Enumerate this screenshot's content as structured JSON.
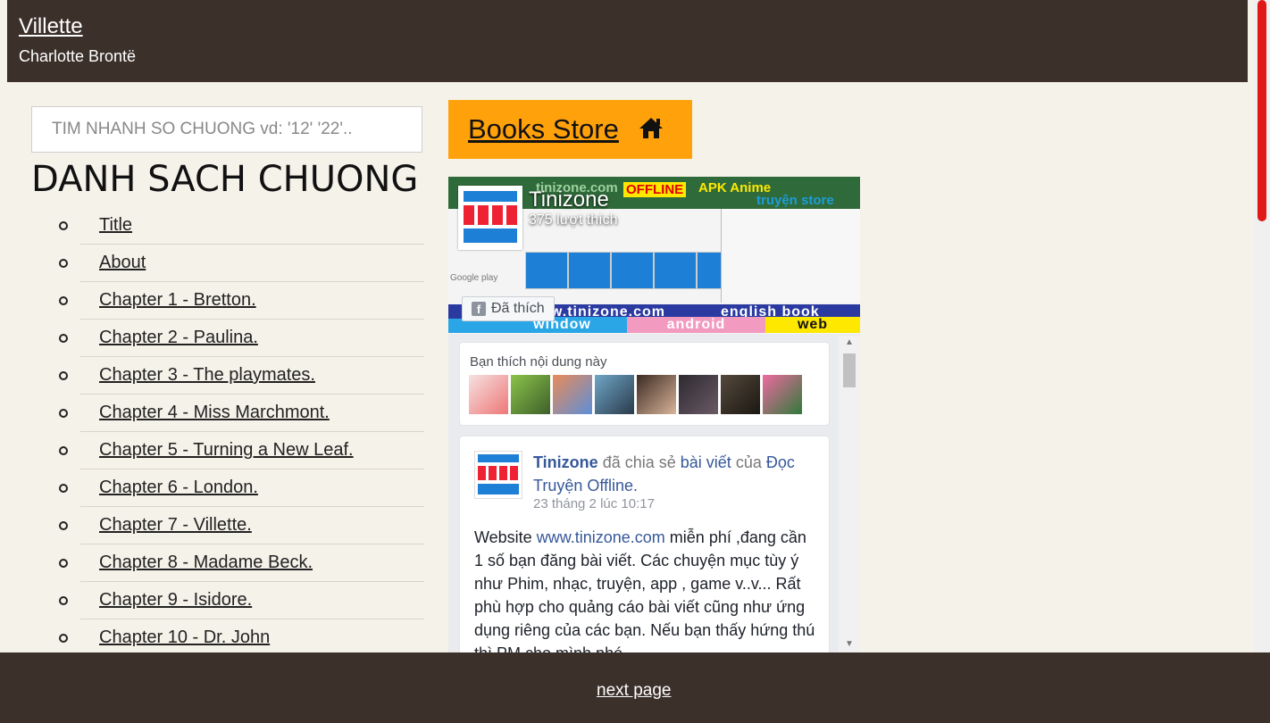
{
  "header": {
    "title": "Villette",
    "author": "Charlotte Brontë"
  },
  "search": {
    "placeholder": "TIM NHANH SO CHUONG vd: '12' '22'.."
  },
  "toc": {
    "heading": "DANH SACH CHUONG",
    "items": [
      "Title",
      "About",
      "Chapter 1 - Bretton.",
      "Chapter 2 - Paulina.",
      "Chapter 3 - The playmates.",
      "Chapter 4 - Miss Marchmont.",
      "Chapter 5 - Turning a New Leaf.",
      "Chapter 6 - London.",
      "Chapter 7 - Villette.",
      "Chapter 8 - Madame Beck.",
      "Chapter 9 - Isidore.",
      "Chapter 10 - Dr. John"
    ]
  },
  "store_button": {
    "label": "Books Store",
    "icon": "home-icon"
  },
  "fb_widget": {
    "page_name": "Tinizone",
    "likes": "375 lượt thích",
    "liked_label": "Đã thích",
    "cover": {
      "top_strip": [
        "tinizone.com",
        "OFFLINE",
        "APK Anime",
        "truyện store"
      ],
      "site": "www.tinizone.com",
      "english": "english book",
      "bands": [
        "window",
        "android",
        "web"
      ],
      "google_play": "Google play"
    },
    "friends_title": "Bạn thích nội dung này",
    "post": {
      "author": "Tinizone",
      "shared": "đã chia sẻ",
      "post_link": "bài viết",
      "of": "của",
      "source": "Đọc Truyện Offline.",
      "time": "23 tháng 2 lúc 10:17",
      "body_prefix": "Website",
      "body_link": "www.tinizone.com",
      "body_rest": "miễn phí ,đang cần 1 số bạn đăng bài viết. Các chuyện mục tùy ý như Phim, nhạc, truyện, app , game v..v... Rất phù hợp cho quảng cáo bài viết cũng như ứng dụng riêng của các bạn. Nếu bạn thấy hứng thú thì PM cho mình nhé"
    },
    "colors": {
      "fb_link": "#365899",
      "band_window": "#2aa6e6",
      "band_android": "#f29ac0",
      "band_web": "#ffe800"
    }
  },
  "footer": {
    "next_label": "next page"
  },
  "colors": {
    "header_bg": "#3b302a",
    "page_bg": "#f5f2ea",
    "store_bg": "#ffa10a",
    "scroll_thumb": "#e01818"
  }
}
